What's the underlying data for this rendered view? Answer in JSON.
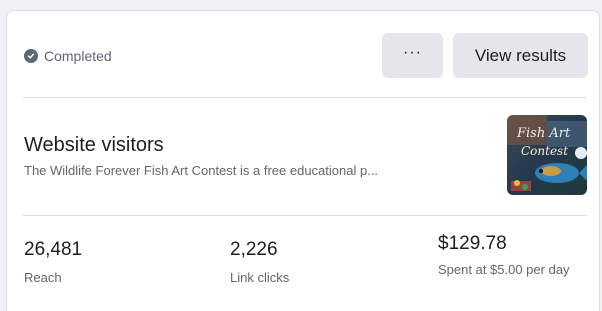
{
  "status": {
    "label": "Completed",
    "icon": "check-circle-icon"
  },
  "actions": {
    "more_label": "···",
    "view_results_label": "View results"
  },
  "ad": {
    "title": "Website visitors",
    "description": "The Wildlife Forever Fish Art Contest is a free educational p..."
  },
  "metrics": {
    "reach": {
      "value": "26,481",
      "label": "Reach"
    },
    "link_clicks": {
      "value": "2,226",
      "label": "Link clicks"
    },
    "spent": {
      "value": "$129.78",
      "label": "Spent at $5.00 per day"
    }
  },
  "colors": {
    "text_primary": "#1c1e21",
    "text_secondary": "#606770",
    "button_bg": "#e4e6eb",
    "divider": "#dadde1",
    "page_bg": "#f0f2f5"
  }
}
